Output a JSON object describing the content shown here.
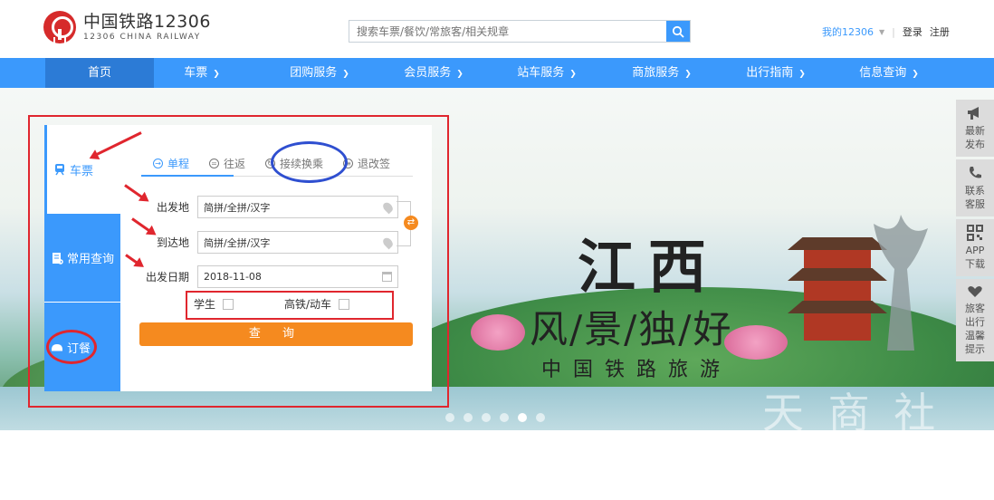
{
  "header": {
    "logo_cn": "中国铁路12306",
    "logo_en": "12306 CHINA RAILWAY",
    "search_placeholder": "搜索车票/餐饮/常旅客/相关规章",
    "my_account": "我的12306",
    "login": "登录",
    "register": "注册"
  },
  "nav": {
    "items": [
      {
        "label": "首页",
        "has_dropdown": false,
        "active": true
      },
      {
        "label": "车票",
        "has_dropdown": true
      },
      {
        "label": "团购服务",
        "has_dropdown": true
      },
      {
        "label": "会员服务",
        "has_dropdown": true
      },
      {
        "label": "站车服务",
        "has_dropdown": true
      },
      {
        "label": "商旅服务",
        "has_dropdown": true
      },
      {
        "label": "出行指南",
        "has_dropdown": true
      },
      {
        "label": "信息查询",
        "has_dropdown": true
      }
    ]
  },
  "booking": {
    "side_tabs": [
      {
        "label": "车票",
        "icon": "train-icon",
        "active": true
      },
      {
        "label": "常用查询",
        "icon": "query-doc-icon"
      },
      {
        "label": "订餐",
        "icon": "meal-icon"
      }
    ],
    "trip_tabs": [
      {
        "label": "单程",
        "active": true
      },
      {
        "label": "往返"
      },
      {
        "label": "接续换乘"
      },
      {
        "label": "退改签"
      }
    ],
    "from_label": "出发地",
    "from_value": "简拼/全拼/汉字",
    "to_label": "到达地",
    "to_value": "简拼/全拼/汉字",
    "date_label": "出发日期",
    "date_value": "2018-11-08",
    "student_label": "学生",
    "highspeed_label": "高铁/动车",
    "query_button": "查 询"
  },
  "banner": {
    "title": "江西",
    "subtitle": "风/景/独/好",
    "tagline": "中国铁路旅游",
    "slide_count": 6,
    "active_slide": 5
  },
  "side_tools": [
    {
      "label": "最新发布",
      "icon": "megaphone-icon"
    },
    {
      "label": "联系客服",
      "icon": "phone-icon"
    },
    {
      "label": "APP下载",
      "icon": "qrcode-icon"
    },
    {
      "label": "旅客出行温馨提示",
      "icon": "heart-hand-icon"
    }
  ],
  "colors": {
    "brand_blue": "#3b99fc",
    "nav_active": "#2c7bd6",
    "accent_orange": "#f58a1f",
    "annotation_red": "#e0262e",
    "annotation_blue": "#2f4fd0"
  }
}
